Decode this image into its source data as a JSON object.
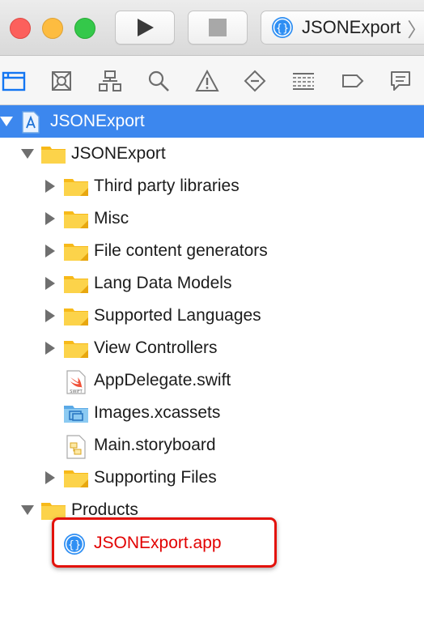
{
  "toolbar": {
    "scheme_name": "JSONExport",
    "run_label": "Run",
    "stop_label": "Stop"
  },
  "navigator": {
    "tabs": [
      "project-navigator",
      "source-control-navigator",
      "symbol-navigator",
      "find-navigator",
      "issue-navigator",
      "test-navigator",
      "debug-navigator",
      "breakpoint-navigator",
      "report-navigator"
    ]
  },
  "tree": {
    "project": "JSONExport",
    "group": "JSONExport",
    "items": [
      "Third party libraries",
      "Misc",
      "File content generators",
      "Lang Data Models",
      "Supported Languages",
      "View Controllers",
      "AppDelegate.swift",
      "Images.xcassets",
      "Main.storyboard",
      "Supporting Files"
    ],
    "products_group": "Products",
    "product": "JSONExport.app"
  },
  "colors": {
    "selection": "#3c87ee",
    "folder": "#fbc927",
    "product_text": "#e20000",
    "highlight_border": "#e3120b"
  }
}
